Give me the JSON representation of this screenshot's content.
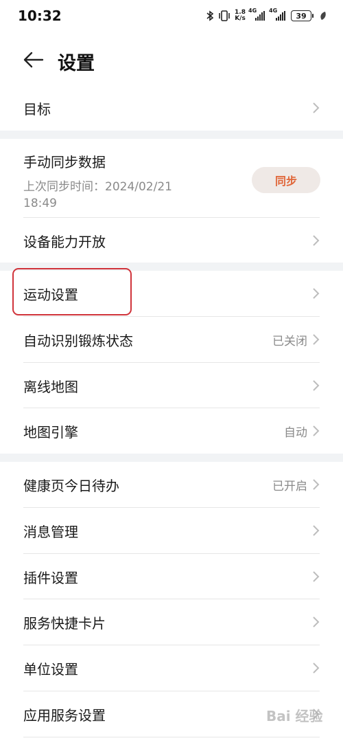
{
  "status_bar": {
    "time": "10:32",
    "speed_value": "1.8",
    "speed_unit": "K/s",
    "network_1": "4G",
    "network_2": "4G",
    "battery": "39",
    "icons": [
      "bluetooth-icon",
      "vibrate-icon",
      "signal-icon",
      "signal-icon",
      "battery-icon",
      "leaf-icon"
    ]
  },
  "header": {
    "title": "设置",
    "back_icon": "back-arrow-icon"
  },
  "group1": {
    "items": [
      {
        "label": "目标",
        "value": ""
      }
    ]
  },
  "group2": {
    "sync": {
      "title": "手动同步数据",
      "last_sync": "上次同步时间：2024/02/21 18:49",
      "button": "同步"
    },
    "items": [
      {
        "label": "设备能力开放",
        "value": ""
      }
    ]
  },
  "group3": {
    "items": [
      {
        "label": "运动设置",
        "value": ""
      },
      {
        "label": "自动识别锻炼状态",
        "value": "已关闭"
      },
      {
        "label": "离线地图",
        "value": ""
      },
      {
        "label": "地图引擎",
        "value": "自动"
      }
    ]
  },
  "group4": {
    "items": [
      {
        "label": "健康页今日待办",
        "value": "已开启"
      },
      {
        "label": "消息管理",
        "value": ""
      },
      {
        "label": "插件设置",
        "value": ""
      },
      {
        "label": "服务快捷卡片",
        "value": ""
      },
      {
        "label": "单位设置",
        "value": ""
      },
      {
        "label": "应用服务设置",
        "value": ""
      }
    ]
  },
  "colors": {
    "background": "#f1f3f5",
    "card": "#ffffff",
    "accent": "#e0673a",
    "highlight": "#d0333a"
  },
  "watermark": "Bai 经验"
}
